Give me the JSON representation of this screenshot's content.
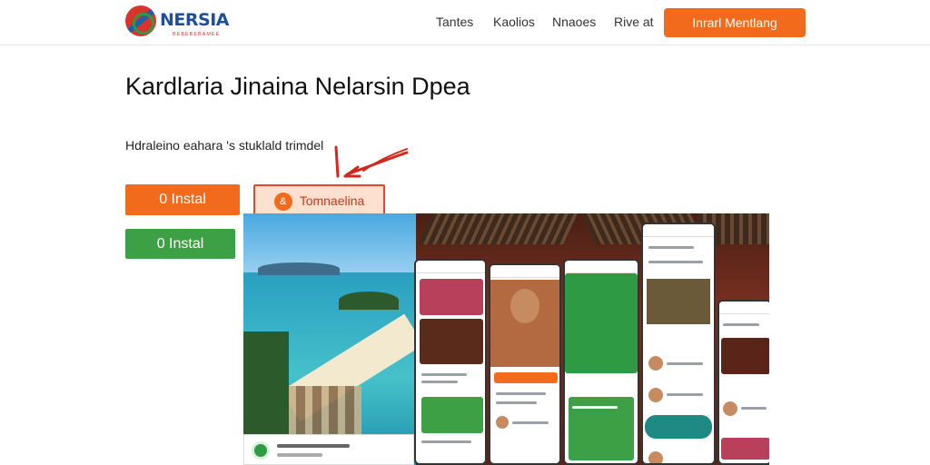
{
  "brand": {
    "name": "NERSIA",
    "tagline": "BEBEBEBAMEE"
  },
  "nav": {
    "items": [
      "Tantes",
      "Kaolios",
      "Nnaoes",
      "Rive at"
    ]
  },
  "header_cta": "Inrarl Mentlang",
  "hero": {
    "title": "Kardlaria Jinaina Nelarsin Dpea",
    "subtitle": "Hdraleino eahara 's stuklald trimdel"
  },
  "buttons": {
    "install_orange": "0 Instal",
    "install_green": "0 Instal",
    "outline": "Tomnaelina",
    "outline_icon": "&"
  },
  "colors": {
    "accent_orange": "#f26a1b",
    "green": "#3ea045",
    "outline_red": "#e3482c",
    "annotation_red": "#d4261c"
  },
  "icons": {
    "outline_button": "download-icon",
    "annotation": "arrow-annotation-icon"
  }
}
